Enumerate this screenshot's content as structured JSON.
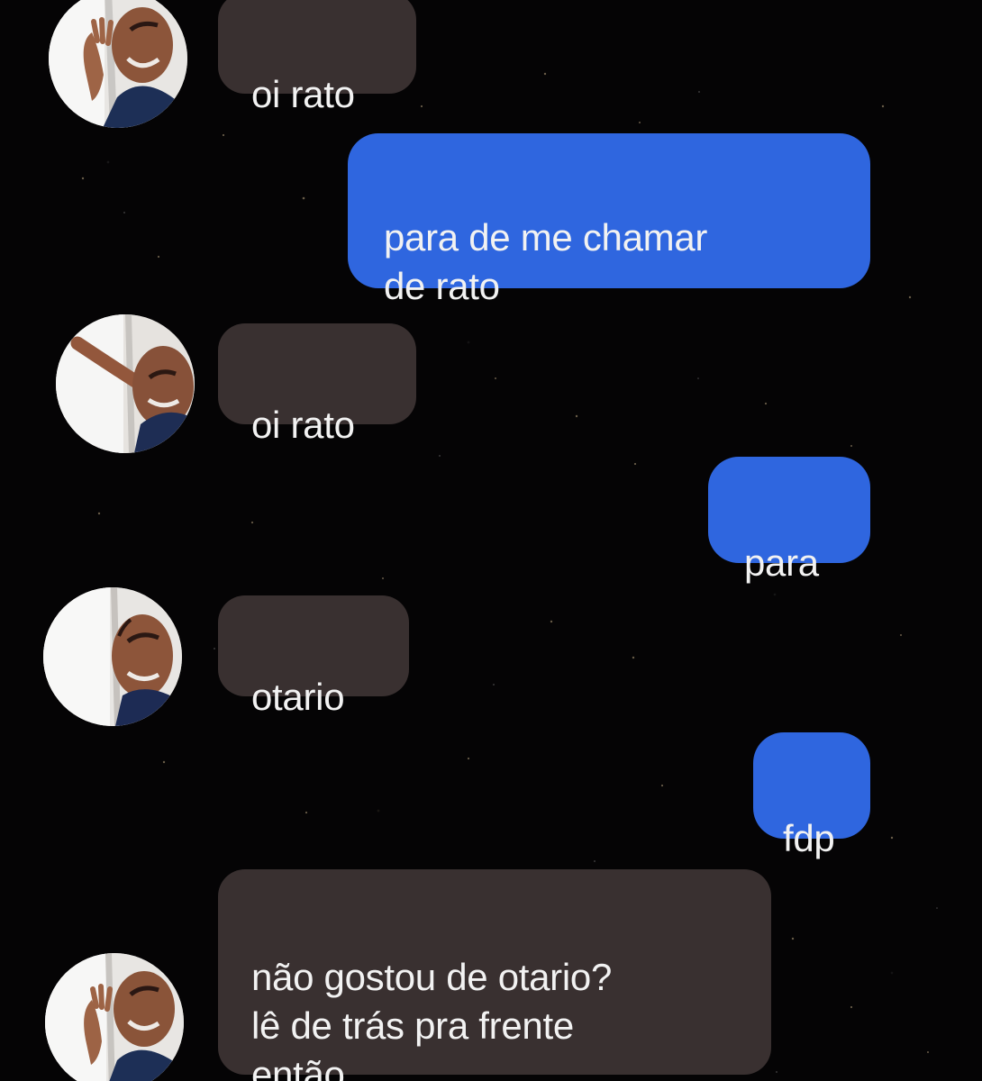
{
  "conversation": {
    "messages": [
      {
        "side": "incoming",
        "text": "oi rato",
        "avatar": "smiling-man-avatar-1"
      },
      {
        "side": "outgoing",
        "text": "para de me chamar\nde rato"
      },
      {
        "side": "incoming",
        "text": "oi rato",
        "avatar": "smiling-man-avatar-2"
      },
      {
        "side": "outgoing",
        "text": "para"
      },
      {
        "side": "incoming",
        "text": "otario",
        "avatar": "smiling-man-avatar-3"
      },
      {
        "side": "outgoing",
        "text": "fdp"
      },
      {
        "side": "incoming",
        "text": "não gostou de otario?\nlê de trás pra frente\nentão",
        "avatar": "smiling-man-avatar-4"
      }
    ]
  },
  "colors": {
    "background": "#050405",
    "incoming_bubble": "#393030",
    "outgoing_bubble": "#2f66df",
    "text": "#f2f2f2"
  }
}
